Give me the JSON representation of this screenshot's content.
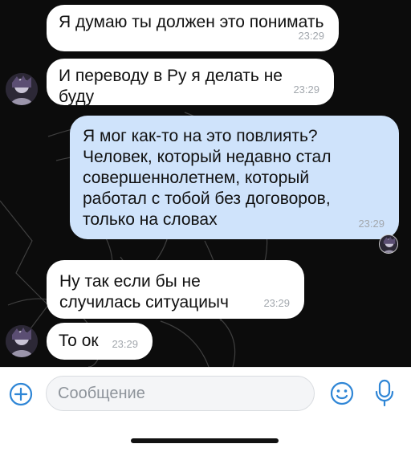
{
  "messages": [
    {
      "text": "Я думаю ты должен это понимать",
      "time": "23:29"
    },
    {
      "text": "И переводу в Ру я делать не буду",
      "time": "23:29"
    },
    {
      "text": "Я мог как-то на это повлиять? Человек, который недавно стал совершеннолетнем, который работал с тобой без договоров, только на словах",
      "time": "23:29"
    },
    {
      "text": "Ну так если бы не случилась ситуациыч",
      "time": "23:29"
    },
    {
      "text": "То ок",
      "time": "23:29"
    }
  ],
  "composer": {
    "placeholder": "Сообщение",
    "left_icon": "add-icon",
    "right_icons": [
      "emoji-icon",
      "microphone-icon"
    ]
  },
  "colors": {
    "incoming_bubble": "#ffffff",
    "outgoing_bubble": "#cfe3fb",
    "chat_background": "#0c0c0c",
    "accent": "#2f86d6"
  }
}
